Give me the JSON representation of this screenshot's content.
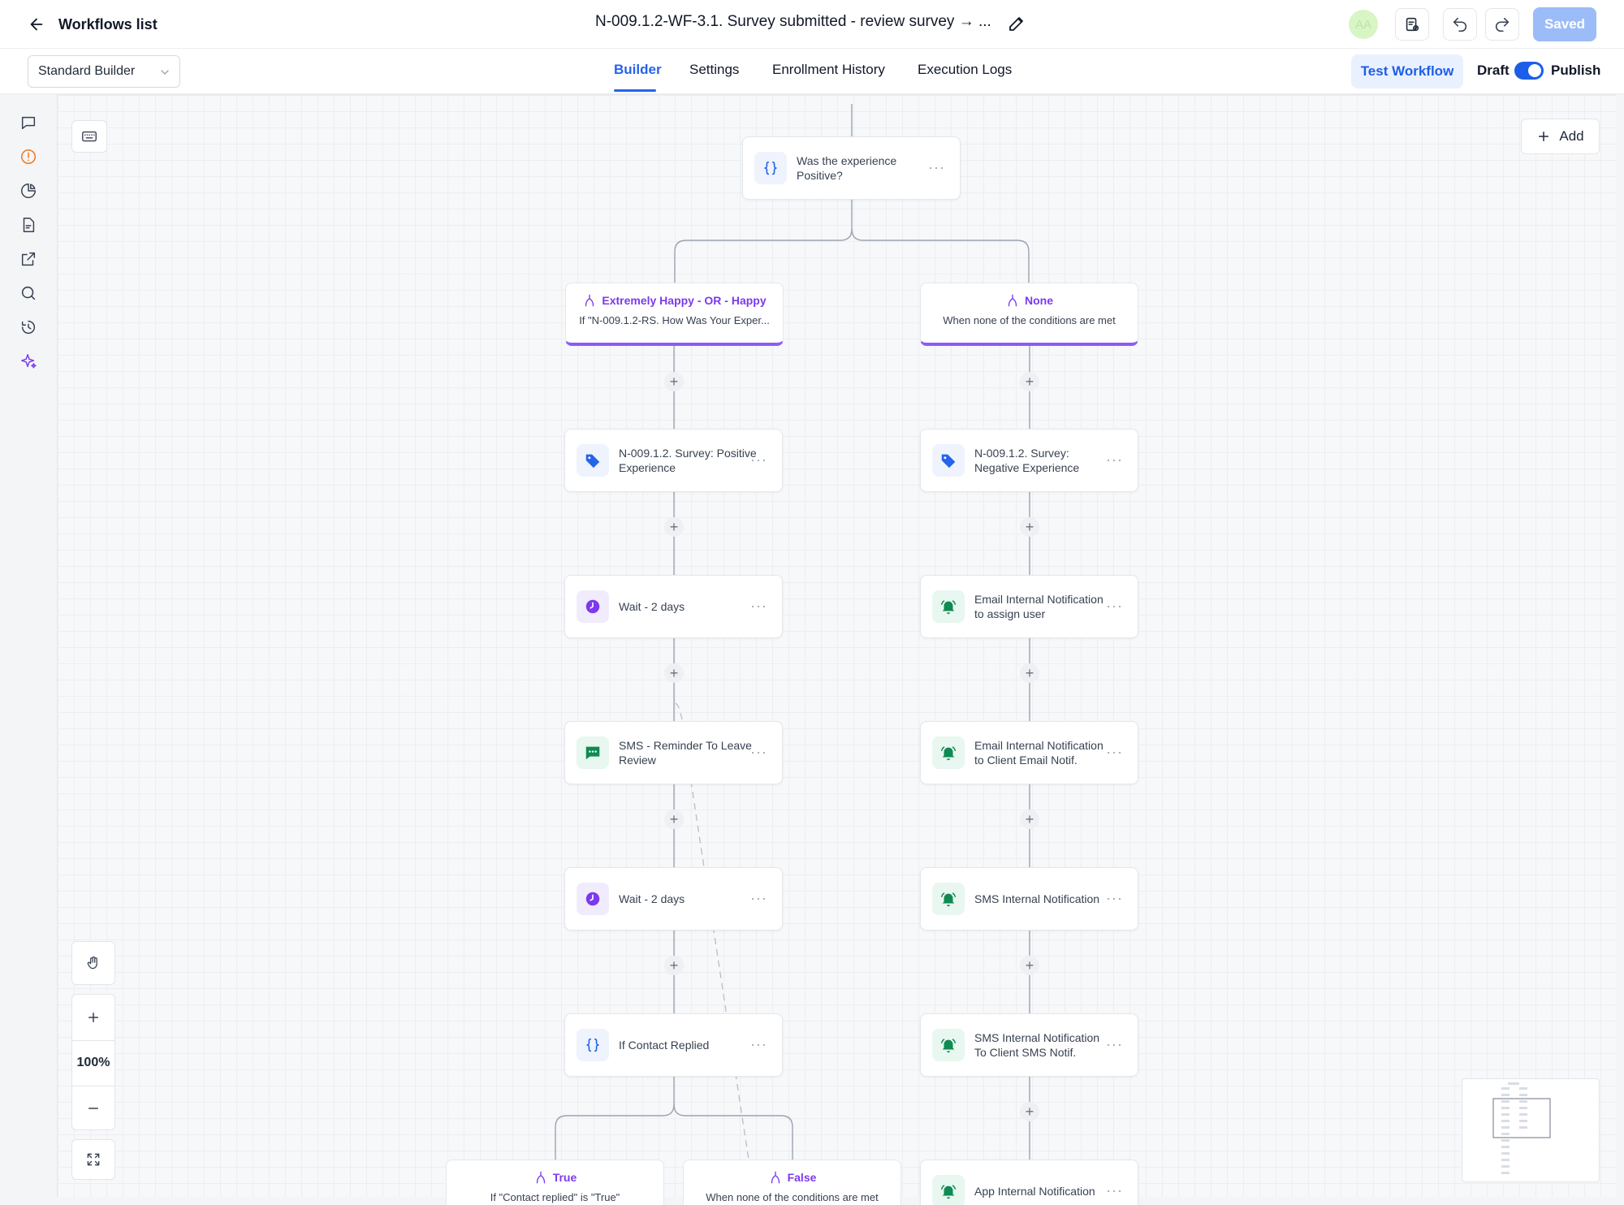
{
  "header": {
    "back_label": "Workflows list",
    "title": "N-009.1.2-WF-3.1. Survey submitted - review survey → ...",
    "avatar": "AA",
    "saved_label": "Saved"
  },
  "subbar": {
    "builder_select": "Standard Builder",
    "tabs": [
      "Builder",
      "Settings",
      "Enrollment History",
      "Execution Logs"
    ],
    "active_tab": "Builder",
    "test_label": "Test Workflow",
    "draft_label": "Draft",
    "publish_label": "Publish",
    "published": true
  },
  "rail": {
    "icons": [
      "chat-icon",
      "alert-icon",
      "pie-chart-icon",
      "document-icon",
      "external-link-icon",
      "search-icon",
      "history-icon",
      "sparkle-icon"
    ]
  },
  "canvas": {
    "add_label": "Add",
    "zoom_label": "100%",
    "top_node": "Was the experience Positive?",
    "branches": [
      {
        "title": "Extremely Happy - OR - Happy",
        "sub": "If \"N-009.1.2-RS. How Was Your Exper..."
      },
      {
        "title": "None",
        "sub": "When none of the conditions are met"
      }
    ],
    "left_nodes": [
      {
        "label": "N-009.1.2. Survey: Positive Experience",
        "icon": "tag-icon"
      },
      {
        "label": "Wait - 2 days",
        "icon": "clock-icon"
      },
      {
        "label": "SMS - Reminder To Leave Review",
        "icon": "sms-icon"
      },
      {
        "label": "Wait - 2 days",
        "icon": "clock-icon"
      },
      {
        "label": "If Contact Replied",
        "icon": "condition-icon"
      }
    ],
    "right_nodes": [
      {
        "label": "N-009.1.2. Survey: Negative Experience",
        "icon": "tag-icon"
      },
      {
        "label": "Email Internal Notification to assign user",
        "icon": "bell-icon"
      },
      {
        "label": "Email Internal Notification to Client Email Notif.",
        "icon": "bell-icon"
      },
      {
        "label": "SMS Internal Notification",
        "icon": "bell-icon"
      },
      {
        "label": "SMS Internal Notification To Client SMS Notif.",
        "icon": "bell-icon"
      },
      {
        "label": "App Internal Notification",
        "icon": "bell-icon"
      }
    ],
    "sub_branches": [
      {
        "title": "True",
        "sub": "If \"Contact replied\" is \"True\""
      },
      {
        "title": "False",
        "sub": "When none of the conditions are met"
      }
    ]
  },
  "colors": {
    "accent": "#2563eb",
    "branch_purple": "#7c3aed",
    "saved_bg": "#9cbcf8"
  }
}
